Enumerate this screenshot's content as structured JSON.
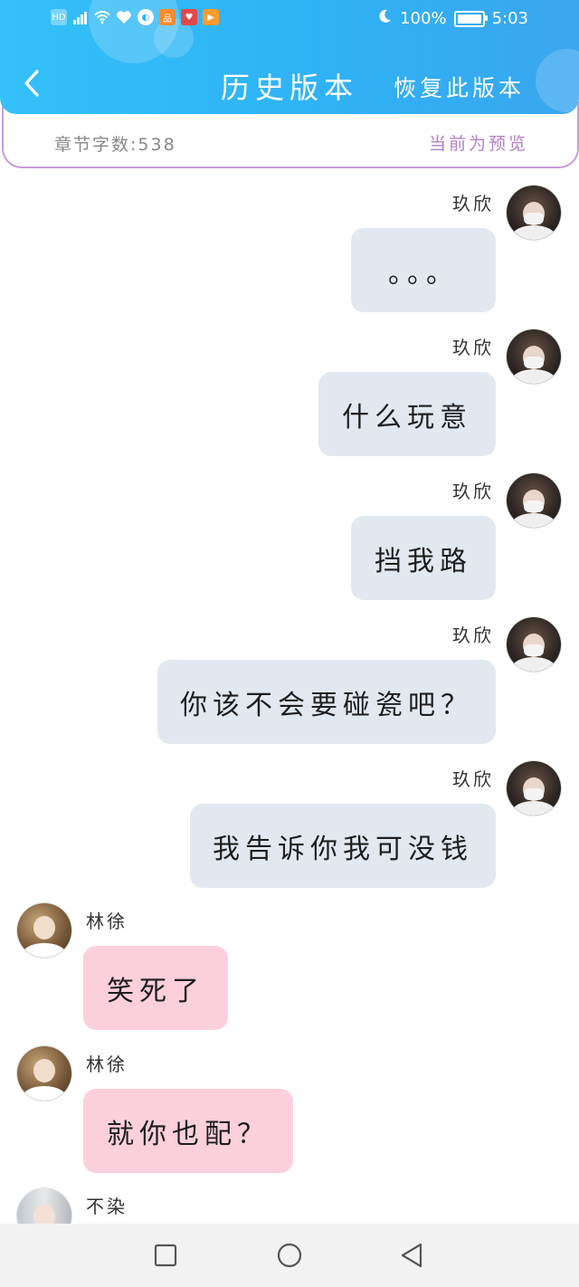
{
  "status_bar": {
    "left_icons": [
      "hd-icon",
      "signal-5g-icon",
      "wifi-icon",
      "heart-icon",
      "app-icon-1",
      "app-icon-2",
      "app-icon-3",
      "app-icon-4"
    ],
    "battery_percent": "100%",
    "battery_level": 1.0,
    "time": "5:03"
  },
  "header": {
    "title": "历史版本",
    "restore_label": "恢复此版本",
    "back_icon": "chevron-left-icon"
  },
  "info_bar": {
    "word_count": "章节字数:538",
    "preview_label": "当前为预览"
  },
  "colors": {
    "header_blue": "#34c0f8",
    "bubble_right": "#e2e8f0",
    "bubble_left": "#fbd0dc",
    "preview_purple": "#b27ec9"
  },
  "messages": [
    {
      "side": "right",
      "name": "玖欣",
      "text": "。。。"
    },
    {
      "side": "right",
      "name": "玖欣",
      "text": "什么玩意"
    },
    {
      "side": "right",
      "name": "玖欣",
      "text": "挡我路"
    },
    {
      "side": "right",
      "name": "玖欣",
      "text": "你该不会要碰瓷吧？"
    },
    {
      "side": "right",
      "name": "玖欣",
      "text": "我告诉你我可没钱"
    },
    {
      "side": "left",
      "name": "林徐",
      "text": "笑死了"
    },
    {
      "side": "left",
      "name": "林徐",
      "text": "就你也配？"
    },
    {
      "side": "left",
      "name": "不染",
      "text": ""
    }
  ],
  "nav_bar": {
    "buttons": [
      "recent-apps-icon",
      "home-icon",
      "back-triangle-icon"
    ]
  }
}
